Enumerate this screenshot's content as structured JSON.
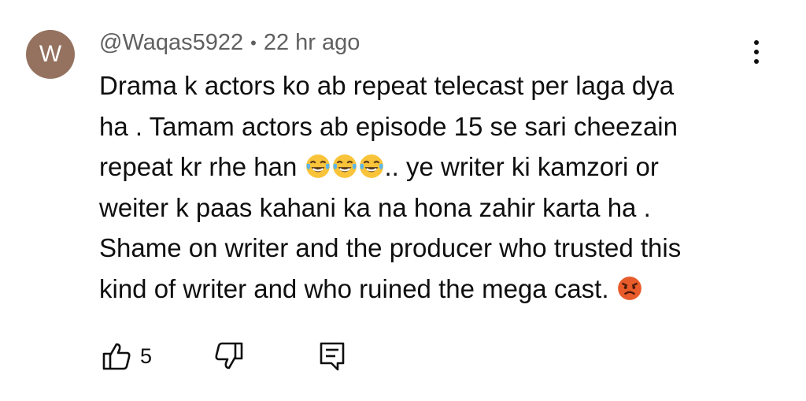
{
  "comment": {
    "avatar_letter": "W",
    "author": "@Waqas5922",
    "separator": "•",
    "timestamp": "22 hr ago",
    "text_lines": [
      "Drama k actors ko ab repeat telecast per laga dya",
      "ha . Tamam actors ab episode 15 se sari cheezain",
      "repeat kr rhe han",
      "..  ye writer ki kamzori or",
      "weiter k paas kahani ka na hona zahir karta ha .",
      "Shame on writer and the producer who trusted this",
      "kind of writer and who ruined the mega cast."
    ],
    "emojis": [
      "face-with-tears-of-joy",
      "face-with-tears-of-joy",
      "face-with-tears-of-joy",
      "angry-face"
    ],
    "likes": "5"
  },
  "icons": {
    "more": "more-vert-icon",
    "like": "thumbs-up-icon",
    "dislike": "thumbs-down-icon",
    "reply": "reply-icon"
  },
  "colors": {
    "avatar_bg": "#94725f",
    "meta_text": "#606060",
    "body_text": "#0f0f0f",
    "emoji_yellow": "#f9c43a",
    "angry_red": "#e85b2a"
  }
}
